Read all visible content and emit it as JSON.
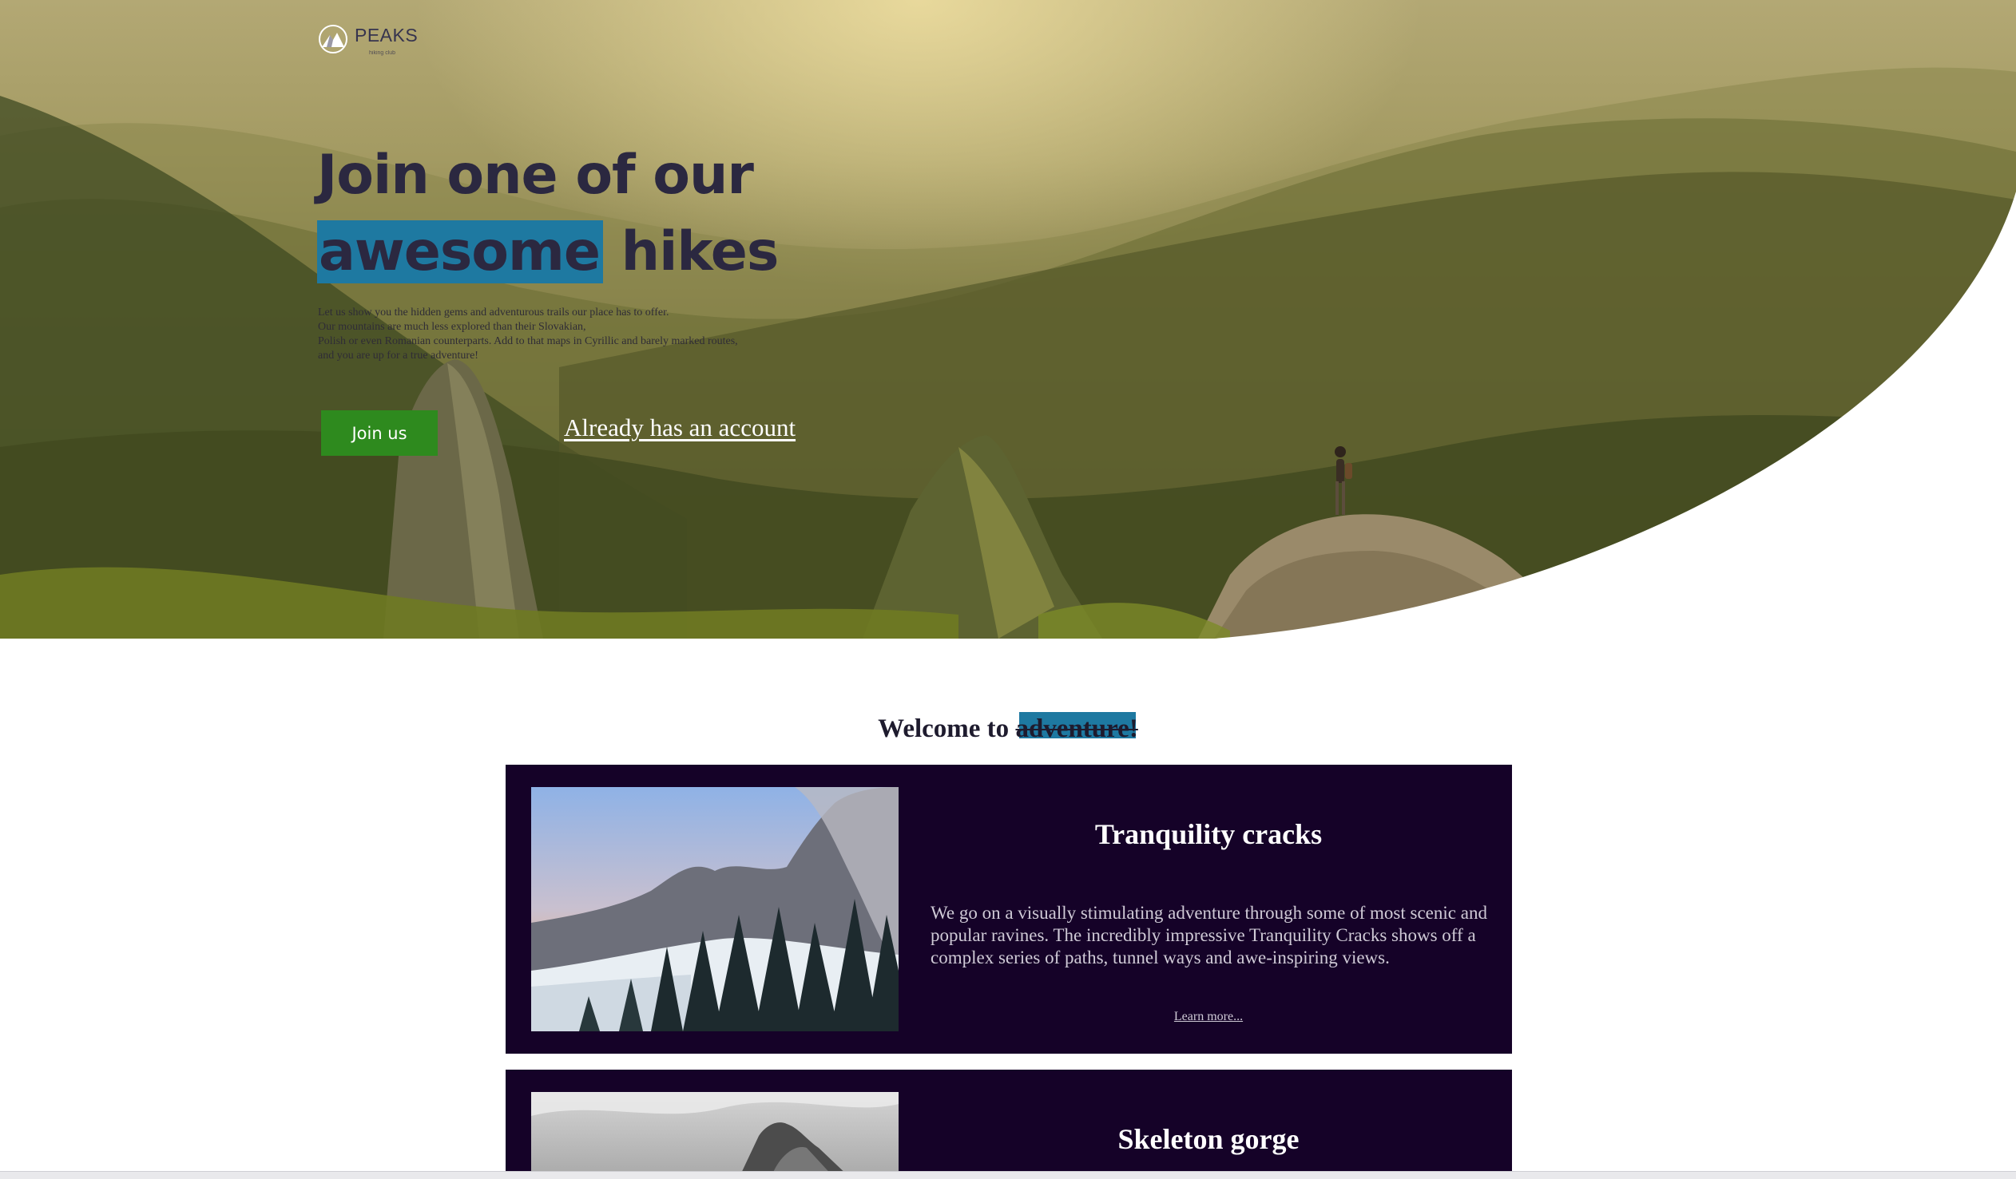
{
  "brand": {
    "name": "PEAKS",
    "tagline": "hiking club"
  },
  "hero": {
    "headline_line1": "Join one of our",
    "headline_highlight": "awesome",
    "headline_rest": " hikes",
    "description_lines": [
      "Let us show you the hidden gems and adventurous trails our place has to offer.",
      "Our mountains are much less explored than their Slovakian,",
      "Polish or even Romanian counterparts. Add to that maps in Cyrillic and barely marked routes,",
      "and you are up for a true adventure!"
    ],
    "join_button": "Join us",
    "account_link": "Already has an account"
  },
  "welcome": {
    "prefix": "Welcome to ",
    "highlight": "adventure!"
  },
  "cards": [
    {
      "title": "Tranquility cracks",
      "text": "We go on a visually stimulating adventure through some of most scenic and popular ravines. The incredibly impressive Tranquility Cracks shows off a complex series of paths, tunnel ways and awe-inspiring views.",
      "link": "Learn more..."
    },
    {
      "title": "Skeleton gorge"
    }
  ],
  "colors": {
    "highlight": "#1e79a1",
    "join_button": "#2e8a1e",
    "card_bg": "#150228",
    "heading_text": "#2b2840"
  }
}
